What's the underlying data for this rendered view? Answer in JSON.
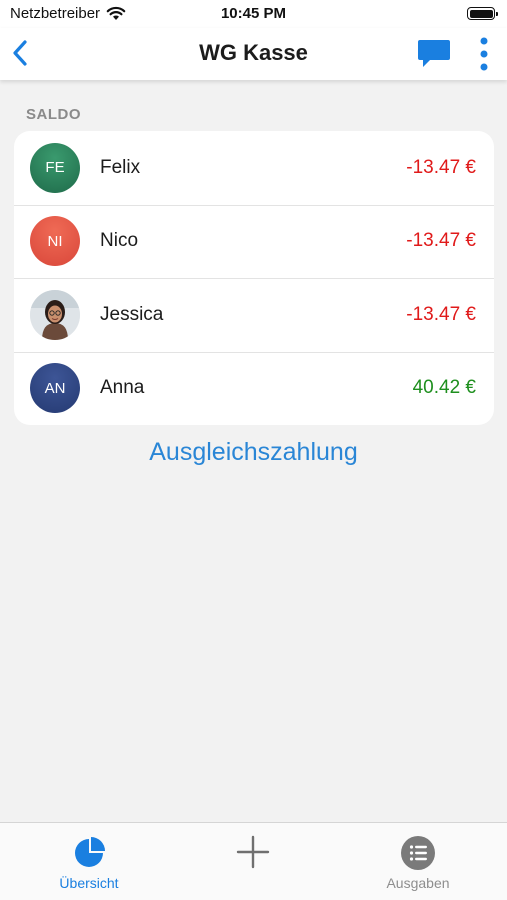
{
  "status_bar": {
    "carrier": "Netzbetreiber",
    "time": "10:45 PM"
  },
  "nav": {
    "title": "WG Kasse",
    "back_icon": "chevron-left-icon",
    "chat_icon": "chat-bubble-icon",
    "more_icon": "more-vertical-icon",
    "accent_color": "#1a7fe0"
  },
  "balance": {
    "section_label": "SALDO",
    "members": [
      {
        "initials": "FE",
        "name": "Felix",
        "amount": "-13.47 €"
      },
      {
        "initials": "NI",
        "name": "Nico",
        "amount": "-13.47 €"
      },
      {
        "initials": "",
        "name": "Jessica",
        "amount": "-13.47 €"
      },
      {
        "initials": "AN",
        "name": "Anna",
        "amount": "40.42 €"
      }
    ],
    "negative_color": "#e01a1a",
    "positive_color": "#1e8f1e"
  },
  "settle_link": "Ausgleichszahlung",
  "tabs": [
    {
      "label": "Übersicht",
      "icon": "pie-chart-icon",
      "active": true
    },
    {
      "label": "",
      "icon": "plus-icon",
      "active": false
    },
    {
      "label": "Ausgaben",
      "icon": "list-icon",
      "active": false
    }
  ]
}
